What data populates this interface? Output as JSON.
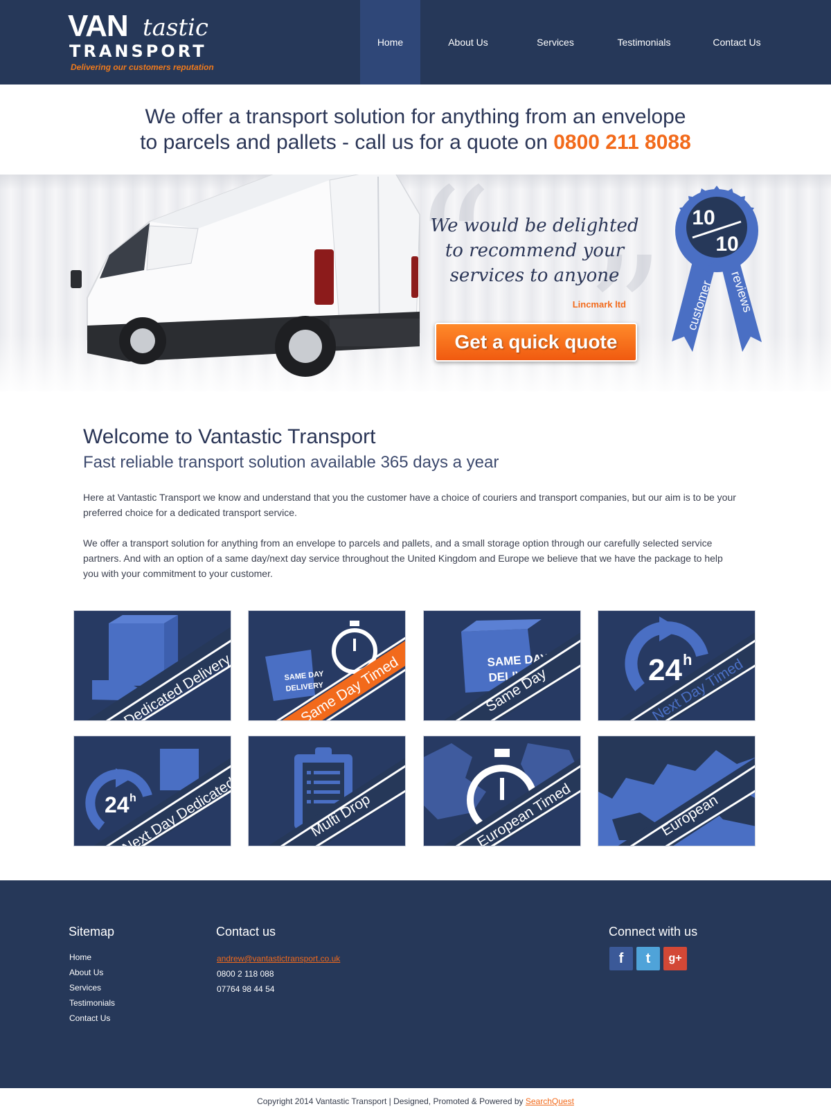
{
  "header": {
    "logo": {
      "van": "VAN",
      "tastic": "tastic",
      "transport": "TRANSPORT",
      "tagline": "Delivering our customers reputation"
    },
    "nav": [
      "Home",
      "About Us",
      "Services",
      "Testimonials",
      "Contact Us"
    ],
    "active_nav": "Home"
  },
  "tagline": {
    "line1": "We offer a transport solution for anything from an envelope",
    "line2_prefix": "to parcels and pallets - call us for a quote on ",
    "phone": "0800 211 8088"
  },
  "hero": {
    "quote_line1": "We would be delighted",
    "quote_line2": "to recommend your",
    "quote_line3": "services to anyone",
    "quote_author": "Lincmark ltd",
    "cta": "Get a quick quote",
    "badge": {
      "top": "10",
      "bottom": "10",
      "ribbon_left": "customer",
      "ribbon_right": "reviews"
    }
  },
  "welcome": {
    "title": "Welcome to Vantastic Transport",
    "subtitle": "Fast reliable transport solution available 365 days a year",
    "para1": "Here at Vantastic Transport we know and understand that you the customer have a choice of couriers and transport companies, but our aim is to be your preferred choice for a dedicated transport service.",
    "para2": "We offer a transport solution for anything from an envelope to parcels and pallets, and a small storage option through our carefully selected service partners. And with an option of a same day/next day service throughout the United Kingdom and Europe we believe that we have the package to help you with your commitment to your customer."
  },
  "services": [
    {
      "label": "Dedicated Delivery",
      "icon": "hand-box-icon"
    },
    {
      "label": "Same Day Timed",
      "icon": "stopwatch-box-icon",
      "box_text1": "SAME DAY",
      "box_text2": "DELIVERY"
    },
    {
      "label": "Same Day",
      "icon": "box-icon",
      "box_text1": "SAME DAY",
      "box_text2": "DELIV"
    },
    {
      "label": "Next Day Timed",
      "icon": "24h-arrow-icon",
      "big": "24",
      "sup": "h"
    },
    {
      "label": "Next Day Dedicated",
      "icon": "24h-box-icon",
      "big": "24",
      "sup": "h"
    },
    {
      "label": "Multi Drop",
      "icon": "clipboard-icon"
    },
    {
      "label": "European Timed",
      "icon": "stopwatch-map-icon"
    },
    {
      "label": "European",
      "icon": "europe-map-icon"
    }
  ],
  "footer": {
    "sitemap_title": "Sitemap",
    "sitemap": [
      "Home",
      "About Us",
      "Services",
      "Testimonials",
      "Contact Us"
    ],
    "contact_title": "Contact us",
    "email": "andrew@vantastictransport.co.uk",
    "phone1": "0800 2 118 088",
    "phone2": "07764 98 44 54",
    "connect_title": "Connect with us",
    "social": [
      {
        "name": "facebook",
        "glyph": "f",
        "color": "#3b5998"
      },
      {
        "name": "twitter",
        "glyph": "t",
        "color": "#4fa3d9"
      },
      {
        "name": "google-plus",
        "glyph": "g+",
        "color": "#d34836"
      }
    ]
  },
  "copyright": {
    "text": "Copyright 2014 Vantastic Transport | Designed, Promoted & Powered by ",
    "link": "SearchQuest"
  },
  "colors": {
    "navy": "#263859",
    "accent": "#f26a1b",
    "tile_blue": "#4a6fc4"
  }
}
